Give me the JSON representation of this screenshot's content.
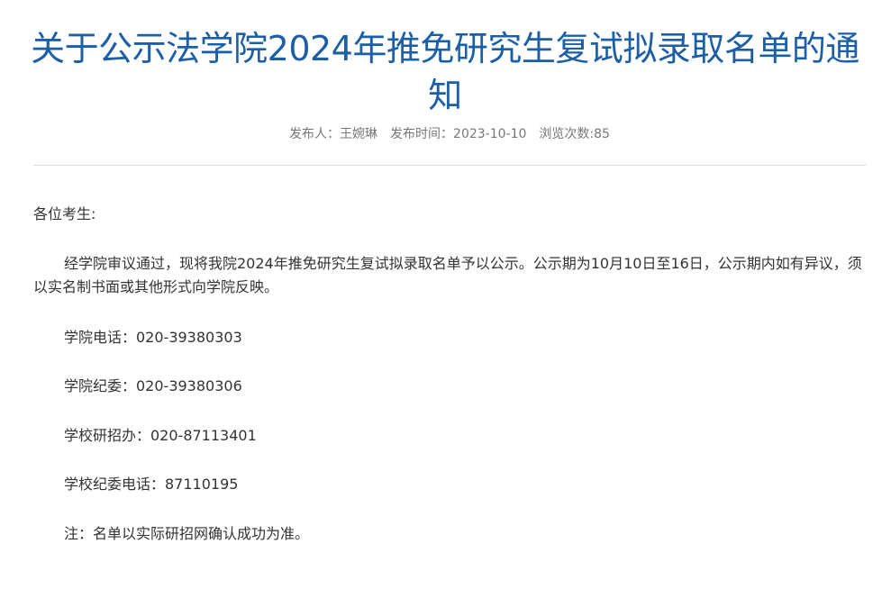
{
  "article": {
    "title": "关于公示法学院2024年推免研究生复试拟录取名单的通知",
    "meta": {
      "publisher_label": "发布人：",
      "publisher": "王婉琳",
      "date_label": "发布时间：",
      "date": "2023-10-10",
      "views_label": "浏览次数:",
      "views": "85"
    },
    "body": {
      "greeting": "各位考生:",
      "paragraph": "经学院审议通过，现将我院2024年推免研究生复试拟录取名单予以公示。公示期为10月10日至16日，公示期内如有异议，须以实名制书面或其他形式向学院反映。",
      "contacts": [
        "学院电话：020-39380303",
        "学院纪委：020-39380306",
        "学校研招办：020-87113401",
        "学校纪委电话：87110195"
      ],
      "note": "注：名单以实际研招网确认成功为准。"
    }
  }
}
